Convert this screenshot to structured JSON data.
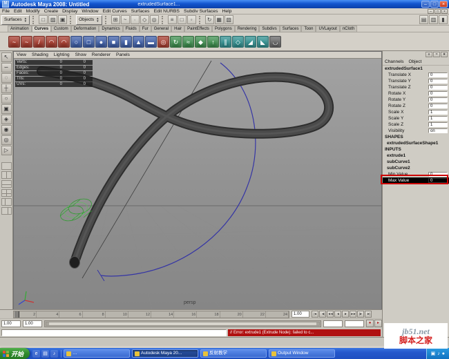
{
  "window": {
    "title": "Autodesk Maya 2008: Untitled",
    "document": "extrudedSurface1...",
    "minimize": "–",
    "maximize": "□",
    "close": "×"
  },
  "menu_bar": {
    "items": [
      {
        "name": "menu-file",
        "label": "File"
      },
      {
        "name": "menu-edit",
        "label": "Edit"
      },
      {
        "name": "menu-modify",
        "label": "Modify"
      },
      {
        "name": "menu-create",
        "label": "Create"
      },
      {
        "name": "menu-display",
        "label": "Display"
      },
      {
        "name": "menu-window",
        "label": "Window"
      },
      {
        "name": "menu-edit-curves",
        "label": "Edit Curves"
      },
      {
        "name": "menu-surfaces",
        "label": "Surfaces"
      },
      {
        "name": "menu-edit-nurbs",
        "label": "Edit NURBS"
      },
      {
        "name": "menu-subdiv-surfaces",
        "label": "Subdiv Surfaces"
      },
      {
        "name": "menu-help",
        "label": "Help"
      }
    ]
  },
  "status_line": {
    "mode": "Surfaces",
    "objects": "Objects",
    "file_icons": [
      {
        "name": "new-scene-icon",
        "glyph": "□"
      },
      {
        "name": "open-scene-icon",
        "glyph": "▨"
      },
      {
        "name": "save-scene-icon",
        "glyph": "▣"
      }
    ],
    "snap_icons": [
      {
        "name": "snap-grid-icon",
        "glyph": "⊞"
      },
      {
        "name": "snap-curve-icon",
        "glyph": "~"
      },
      {
        "name": "snap-point-icon",
        "glyph": "∙"
      },
      {
        "name": "snap-plane-icon",
        "glyph": "◇"
      },
      {
        "name": "make-live-icon",
        "glyph": "◎"
      }
    ],
    "select_icons": [
      {
        "name": "select-hierarchy-icon",
        "glyph": "≡"
      },
      {
        "name": "select-object-icon",
        "glyph": "□"
      },
      {
        "name": "select-component-icon",
        "glyph": "◦"
      }
    ],
    "render_icons": [
      {
        "name": "construction-history-icon",
        "glyph": "↻"
      },
      {
        "name": "render-current-frame-icon",
        "glyph": "▦"
      },
      {
        "name": "ipr-render-icon",
        "glyph": "▧"
      }
    ],
    "panel_icons": [
      {
        "name": "show-attribute-editor-icon",
        "glyph": "▤"
      },
      {
        "name": "show-tool-settings-icon",
        "glyph": "▥"
      },
      {
        "name": "show-channel-box-icon",
        "glyph": "▮"
      }
    ]
  },
  "shelf": {
    "tabs": [
      {
        "name": "tab-animation",
        "label": "Animation"
      },
      {
        "name": "tab-curves",
        "label": "Curves",
        "active": true
      },
      {
        "name": "tab-custom",
        "label": "Custom"
      },
      {
        "name": "tab-deformation",
        "label": "Deformation"
      },
      {
        "name": "tab-dynamics",
        "label": "Dynamics"
      },
      {
        "name": "tab-fluids",
        "label": "Fluids"
      },
      {
        "name": "tab-fur",
        "label": "Fur"
      },
      {
        "name": "tab-general",
        "label": "General"
      },
      {
        "name": "tab-hair",
        "label": "Hair"
      },
      {
        "name": "tab-painteffects",
        "label": "PaintEffects"
      },
      {
        "name": "tab-polygons",
        "label": "Polygons"
      },
      {
        "name": "tab-rendering",
        "label": "Rendering"
      },
      {
        "name": "tab-subdivs",
        "label": "Subdivs"
      },
      {
        "name": "tab-surfaces",
        "label": "Surfaces"
      },
      {
        "name": "tab-toon",
        "label": "Toon"
      },
      {
        "name": "tab-uvlayout",
        "label": "UVLayout"
      },
      {
        "name": "tab-ncloth",
        "label": "nCloth"
      }
    ],
    "icons": [
      {
        "name": "cv-curve-tool-icon",
        "glyph": "~",
        "color": "#a63d2f"
      },
      {
        "name": "ep-curve-tool-icon",
        "glyph": "~",
        "color": "#a63d2f"
      },
      {
        "name": "pencil-curve-tool-icon",
        "glyph": "/",
        "color": "#a63d2f"
      },
      {
        "name": "arc-three-point-icon",
        "glyph": "◠",
        "color": "#a63d2f"
      },
      {
        "name": "arc-two-point-icon",
        "glyph": "◠",
        "color": "#a63d2f"
      },
      {
        "name": "nurbs-circle-icon",
        "glyph": "○",
        "color": "#3f5fa8"
      },
      {
        "name": "nurbs-square-icon",
        "glyph": "□",
        "color": "#3f5fa8"
      },
      {
        "name": "nurbs-sphere-icon",
        "glyph": "●",
        "color": "#3f5fa8"
      },
      {
        "name": "nurbs-cube-icon",
        "glyph": "■",
        "color": "#3f5fa8"
      },
      {
        "name": "nurbs-cylinder-icon",
        "glyph": "▮",
        "color": "#3f5fa8"
      },
      {
        "name": "nurbs-cone-icon",
        "glyph": "▲",
        "color": "#3f5fa8"
      },
      {
        "name": "nurbs-plane-icon",
        "glyph": "▬",
        "color": "#3f5fa8"
      },
      {
        "name": "nurbs-torus-icon",
        "glyph": "◎",
        "color": "#a63d2f"
      },
      {
        "name": "revolve-icon",
        "glyph": "↻",
        "color": "#3f8f4f"
      },
      {
        "name": "loft-icon",
        "glyph": "≈",
        "color": "#3f8f4f"
      },
      {
        "name": "planar-icon",
        "glyph": "◆",
        "color": "#3f8f4f"
      },
      {
        "name": "extrude-icon",
        "glyph": "↑",
        "color": "#3f8f4f"
      },
      {
        "name": "birail-icon",
        "glyph": "∥",
        "color": "#2f8f8f"
      },
      {
        "name": "boundary-icon",
        "glyph": "◇",
        "color": "#2f8f8f"
      },
      {
        "name": "bevel-icon",
        "glyph": "◢",
        "color": "#2f8f8f"
      },
      {
        "name": "bevel-plus-icon",
        "glyph": "◣",
        "color": "#2f8f8f"
      },
      {
        "name": "attach-curves-icon",
        "glyph": "◡",
        "color": "#666666"
      }
    ]
  },
  "toolbox": {
    "tools": [
      {
        "name": "select-tool",
        "glyph": "↖"
      },
      {
        "name": "lasso-tool",
        "glyph": "∽"
      },
      {
        "name": "paint-select-tool",
        "glyph": "◌"
      },
      {
        "name": "move-tool",
        "glyph": "┼"
      },
      {
        "name": "rotate-tool",
        "glyph": "○"
      },
      {
        "name": "scale-tool",
        "glyph": "▣"
      },
      {
        "name": "universal-manipulator-tool",
        "glyph": "◈"
      },
      {
        "name": "soft-mod-tool",
        "glyph": "◉"
      },
      {
        "name": "show-manipulator-tool",
        "glyph": "◎"
      },
      {
        "name": "last-tool",
        "glyph": "▷"
      }
    ],
    "layouts": [
      {
        "name": "layout-single-pane-button",
        "variant": "single"
      },
      {
        "name": "layout-two-pane-side-button",
        "variant": "vsplit"
      },
      {
        "name": "layout-two-pane-stacked-button",
        "variant": "hsplit"
      },
      {
        "name": "layout-four-pane-button",
        "variant": "quad"
      },
      {
        "name": "layout-persp-outliner-button",
        "variant": "left"
      },
      {
        "name": "layout-persp-graph-button",
        "variant": "right"
      }
    ]
  },
  "viewport": {
    "menus": [
      {
        "name": "vp-menu-view",
        "label": "View"
      },
      {
        "name": "vp-menu-shading",
        "label": "Shading"
      },
      {
        "name": "vp-menu-lighting",
        "label": "Lighting"
      },
      {
        "name": "vp-menu-show",
        "label": "Show"
      },
      {
        "name": "vp-menu-renderer",
        "label": "Renderer"
      },
      {
        "name": "vp-menu-panels",
        "label": "Panels"
      }
    ],
    "hud_rows": [
      {
        "label": "Verts:",
        "v1": "0",
        "v2": "0"
      },
      {
        "label": "Edges:",
        "v1": "0",
        "v2": "0"
      },
      {
        "label": "Faces:",
        "v1": "0",
        "v2": "0"
      },
      {
        "label": "Tris:",
        "v1": "0",
        "v2": "0"
      },
      {
        "label": "UVs:",
        "v1": "0",
        "v2": "0"
      }
    ],
    "camera_label": "persp"
  },
  "channel_box": {
    "toolbar_icons": [
      {
        "name": "channel-speed-icon",
        "glyph": "≡"
      },
      {
        "name": "channel-hyperbolic-icon",
        "glyph": "≈"
      },
      {
        "name": "channel-settings-icon",
        "glyph": "∗"
      }
    ],
    "menus": [
      {
        "name": "channels-menu",
        "label": "Channels"
      },
      {
        "name": "object-menu",
        "label": "Object"
      }
    ],
    "object_name": "extrudedSurface1",
    "attrs": [
      {
        "name": "attr-translate-x",
        "label": "Translate X",
        "value": "0"
      },
      {
        "name": "attr-translate-y",
        "label": "Translate Y",
        "value": "0"
      },
      {
        "name": "attr-translate-z",
        "label": "Translate Z",
        "value": "0"
      },
      {
        "name": "attr-rotate-x",
        "label": "Rotate X",
        "value": "0"
      },
      {
        "name": "attr-rotate-y",
        "label": "Rotate Y",
        "value": "0"
      },
      {
        "name": "attr-rotate-z",
        "label": "Rotate Z",
        "value": "0"
      },
      {
        "name": "attr-scale-x",
        "label": "Scale X",
        "value": "1"
      },
      {
        "name": "attr-scale-y",
        "label": "Scale Y",
        "value": "1"
      },
      {
        "name": "attr-scale-z",
        "label": "Scale Z",
        "value": "1"
      },
      {
        "name": "attr-visibility",
        "label": "Visibility",
        "value": "on"
      }
    ],
    "shapes_header": "SHAPES",
    "shape_name": "extrudedSurfaceShape1",
    "inputs_header": "INPUTS",
    "input_nodes": [
      {
        "name": "input-extrude1",
        "label": "extrude1"
      },
      {
        "name": "input-subcurve1",
        "label": "subCurve1"
      },
      {
        "name": "input-subcurve2",
        "label": "subCurve2"
      }
    ],
    "input_attrs": [
      {
        "name": "attr-min-value",
        "label": "Min Value",
        "value": "0"
      },
      {
        "name": "attr-max-value",
        "label": "Max Value",
        "value": "0",
        "selected": true
      }
    ]
  },
  "time_slider": {
    "ticks": [
      {
        "label": "2"
      },
      {
        "label": "4"
      },
      {
        "label": "6"
      },
      {
        "label": "8"
      },
      {
        "label": "10"
      },
      {
        "label": "12"
      },
      {
        "label": "14"
      },
      {
        "label": "16"
      },
      {
        "label": "18"
      },
      {
        "label": "20"
      },
      {
        "label": "22"
      },
      {
        "label": "24"
      }
    ],
    "current_frame": "1.00",
    "playback": [
      {
        "name": "go-to-start-button",
        "glyph": "|◄"
      },
      {
        "name": "prev-key-button",
        "glyph": "◄|"
      },
      {
        "name": "step-back-frame-button",
        "glyph": "◄◄"
      },
      {
        "name": "play-backwards-button",
        "glyph": "◄"
      },
      {
        "name": "play-forward-button",
        "glyph": "►"
      },
      {
        "name": "step-forward-frame-button",
        "glyph": "►►"
      },
      {
        "name": "next-key-button",
        "glyph": "|►"
      },
      {
        "name": "go-to-end-button",
        "glyph": "►|"
      }
    ]
  },
  "range_slider": {
    "range_start": "1.00",
    "anim_start": "1.00",
    "anim_end": "",
    "range_end": "",
    "buttons": [
      {
        "name": "autokey-button",
        "glyph": "●"
      },
      {
        "name": "anim-prefs-button",
        "glyph": "▸"
      }
    ]
  },
  "command_line": {
    "input": "",
    "error": "// Error: extrude1 (Extrude Node): failed to c..."
  },
  "taskbar": {
    "start_label": "开始",
    "quick_launch": [
      {
        "name": "quicklaunch-ie-icon",
        "glyph": "e"
      },
      {
        "name": "quicklaunch-desktop-icon",
        "glyph": "▤"
      },
      {
        "name": "quicklaunch-media-icon",
        "glyph": "♪"
      }
    ],
    "buttons": [
      {
        "name": "task-button-1",
        "label": "…"
      },
      {
        "name": "task-button-maya",
        "label": "Autodesk Maya 20...",
        "active": true
      },
      {
        "name": "task-button-doc",
        "label": "反射教学"
      },
      {
        "name": "task-button-output",
        "label": "Output Window"
      }
    ],
    "tray_icons": [
      {
        "name": "tray-volume-icon",
        "glyph": "▣"
      },
      {
        "name": "tray-media-icon",
        "glyph": "♪"
      },
      {
        "name": "tray-status-icon",
        "glyph": "●"
      }
    ]
  },
  "watermark": {
    "line1": "jb51.net",
    "line2": "脚本之家"
  },
  "colors": {
    "titlebar": "#1355cf",
    "taskbar": "#2558cc",
    "error_bg": "#b01010",
    "annotation": "#cc0000",
    "selection": "#000000"
  }
}
